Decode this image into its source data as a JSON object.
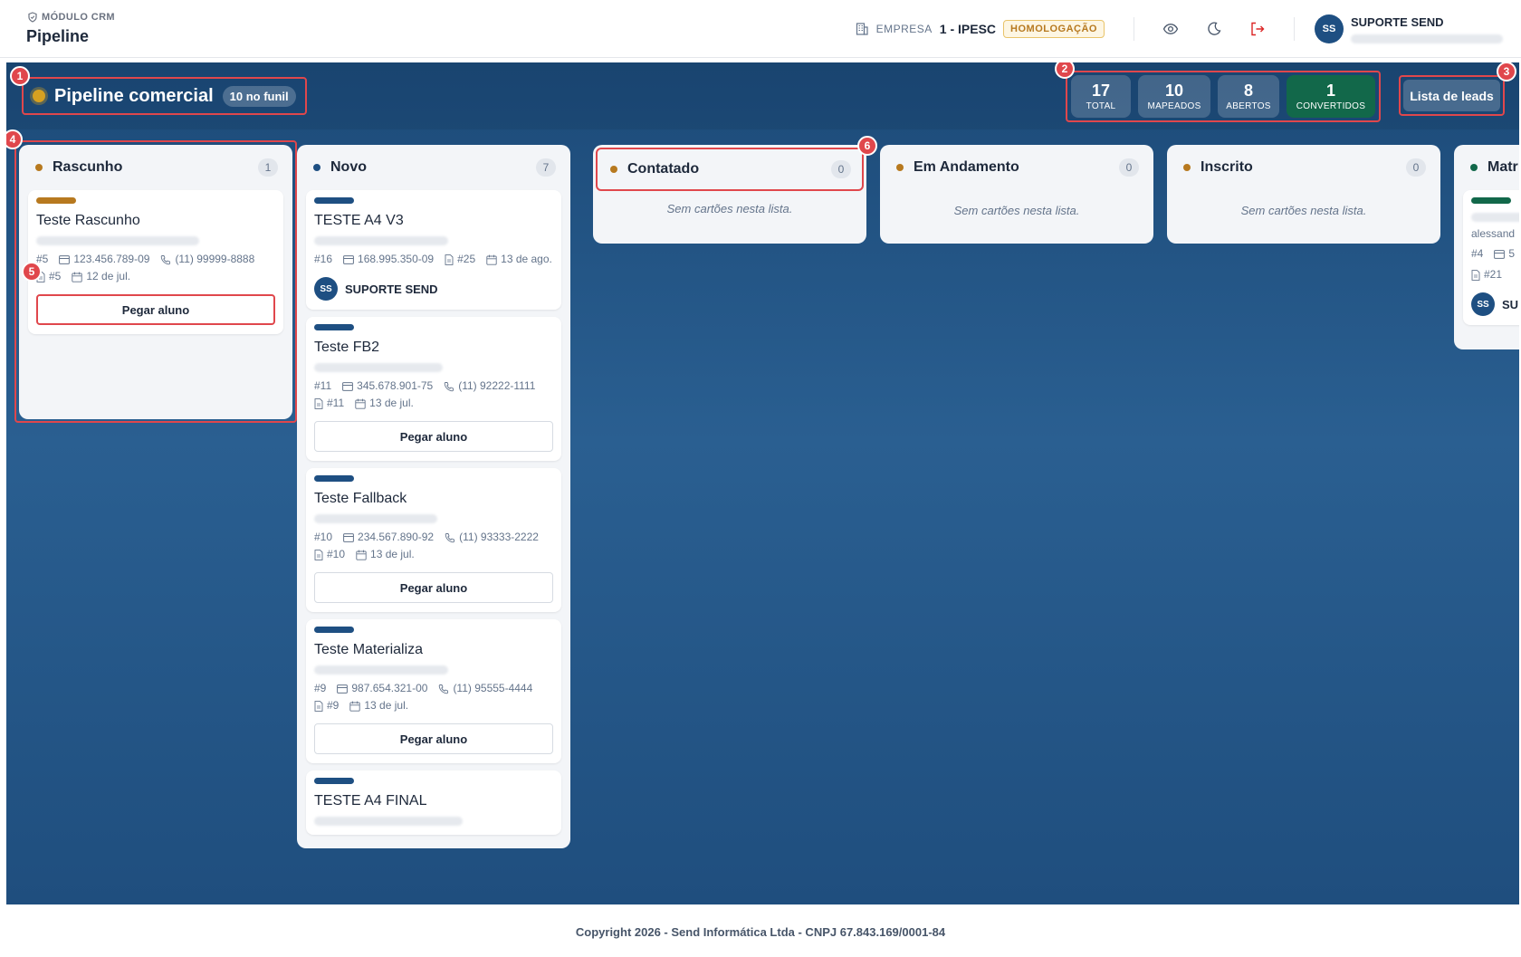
{
  "header": {
    "module_label": "MÓDULO CRM",
    "page_title": "Pipeline",
    "company_label": "EMPRESA",
    "company_value": "1 - IPESC",
    "env_badge": "HOMOLOGAÇÃO",
    "user": {
      "initials": "SS",
      "name": "SUPORTE SEND"
    }
  },
  "board": {
    "title": "Pipeline comercial",
    "funnel_badge": "10 no funil",
    "stats": [
      {
        "value": "17",
        "label": "TOTAL"
      },
      {
        "value": "10",
        "label": "MAPEADOS"
      },
      {
        "value": "8",
        "label": "ABERTOS"
      },
      {
        "value": "1",
        "label": "CONVERTIDOS"
      }
    ],
    "leads_button": "Lista de leads",
    "empty_text": "Sem cartões nesta lista.",
    "pick_label": "Pegar aluno",
    "columns": [
      {
        "title": "Rascunho",
        "count": "1",
        "dot_color": "#b7791f"
      },
      {
        "title": "Novo",
        "count": "7",
        "dot_color": "#1e4f82"
      },
      {
        "title": "Contatado",
        "count": "0",
        "dot_color": "#b7791f"
      },
      {
        "title": "Em Andamento",
        "count": "0",
        "dot_color": "#b7791f"
      },
      {
        "title": "Inscrito",
        "count": "0",
        "dot_color": "#b7791f"
      },
      {
        "title": "Matr",
        "dot_color": "#12684a"
      }
    ],
    "cards": {
      "rascunho": [
        {
          "title": "Teste Rascunho",
          "id": "#5",
          "cpf": "123.456.789-09",
          "phone": "(11) 99999-8888",
          "doc": "#5",
          "date": "12 de jul.",
          "bar_color": "#b7791f"
        }
      ],
      "novo": [
        {
          "title": "TESTE A4 V3",
          "id": "#16",
          "cpf": "168.995.350-09",
          "doc": "#25",
          "date": "13 de ago.",
          "owner": "SUPORTE SEND",
          "owner_initials": "SS",
          "bar_color": "#1e4f82"
        },
        {
          "title": "Teste FB2",
          "id": "#11",
          "cpf": "345.678.901-75",
          "phone": "(11) 92222-1111",
          "doc": "#11",
          "date": "13 de jul.",
          "bar_color": "#1e4f82"
        },
        {
          "title": "Teste Fallback",
          "id": "#10",
          "cpf": "234.567.890-92",
          "phone": "(11) 93333-2222",
          "doc": "#10",
          "date": "13 de jul.",
          "bar_color": "#1e4f82"
        },
        {
          "title": "Teste Materializa",
          "id": "#9",
          "cpf": "987.654.321-00",
          "phone": "(11) 95555-4444",
          "doc": "#9",
          "date": "13 de jul.",
          "bar_color": "#1e4f82"
        },
        {
          "title": "TESTE A4 FINAL",
          "bar_color": "#1e4f82"
        }
      ],
      "matr": [
        {
          "email_partial": "alessand",
          "id": "#4",
          "cpf_partial": "5",
          "doc": "#21",
          "owner_partial": "SU",
          "owner_initials": "SS",
          "bar_color": "#12684a"
        }
      ]
    },
    "markers": [
      "1",
      "2",
      "3",
      "4",
      "5",
      "6"
    ]
  },
  "footer": {
    "text": "Copyright 2026 - Send Informática Ltda - CNPJ 67.843.169/0001-84"
  }
}
